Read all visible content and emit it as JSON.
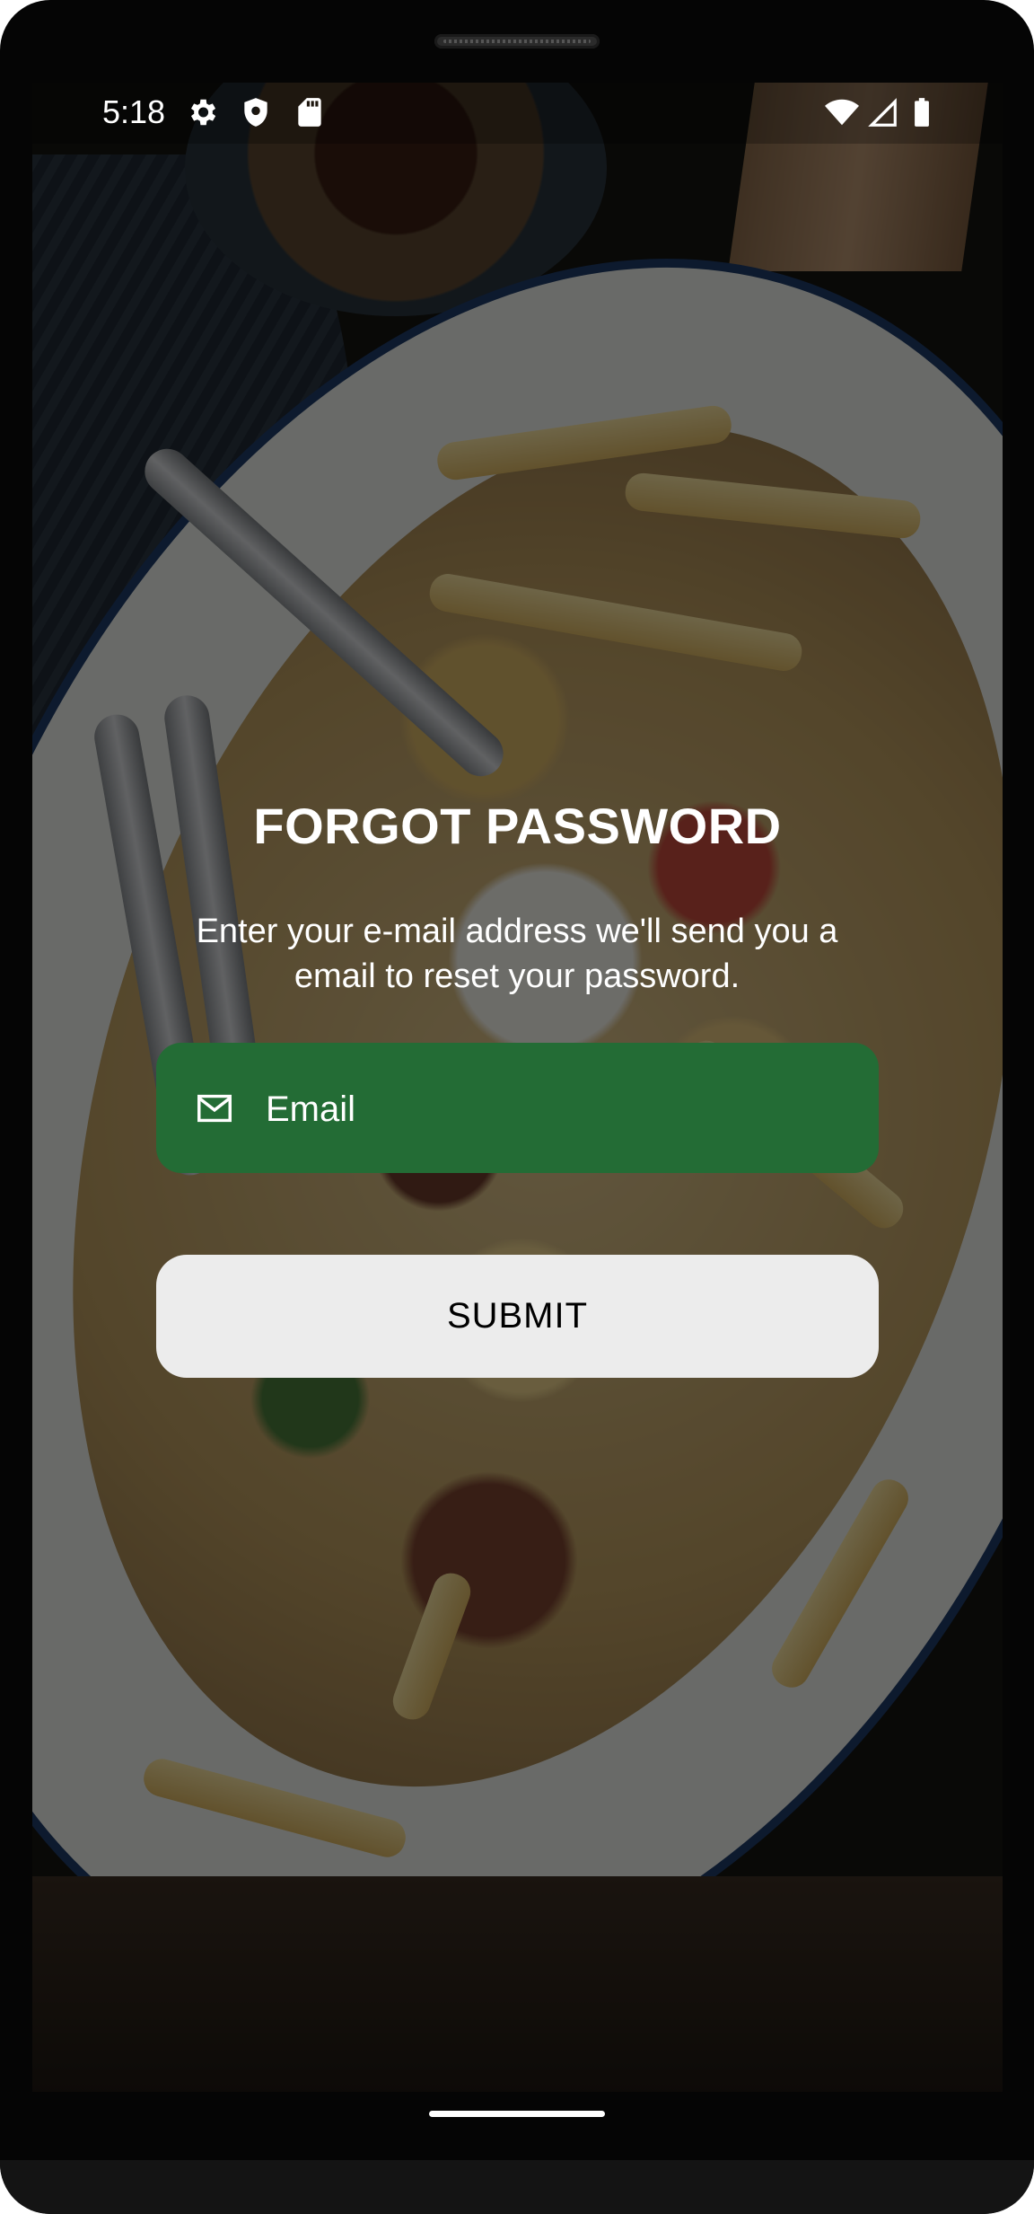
{
  "status_bar": {
    "time": "5:18",
    "left_icons": [
      "gear-icon",
      "shield-icon",
      "sd-card-icon"
    ],
    "right_icons": [
      "wifi-icon",
      "cell-signal-icon",
      "battery-icon"
    ]
  },
  "page": {
    "title": "FORGOT PASSWORD",
    "subtitle": "Enter your e-mail address we'll send you a email to reset your password."
  },
  "form": {
    "email_placeholder": "Email",
    "email_value": "",
    "submit_label": "SUBMIT"
  },
  "colors": {
    "email_field_bg": "#236c35",
    "submit_bg": "#ececec",
    "text_light": "#ffffff"
  }
}
